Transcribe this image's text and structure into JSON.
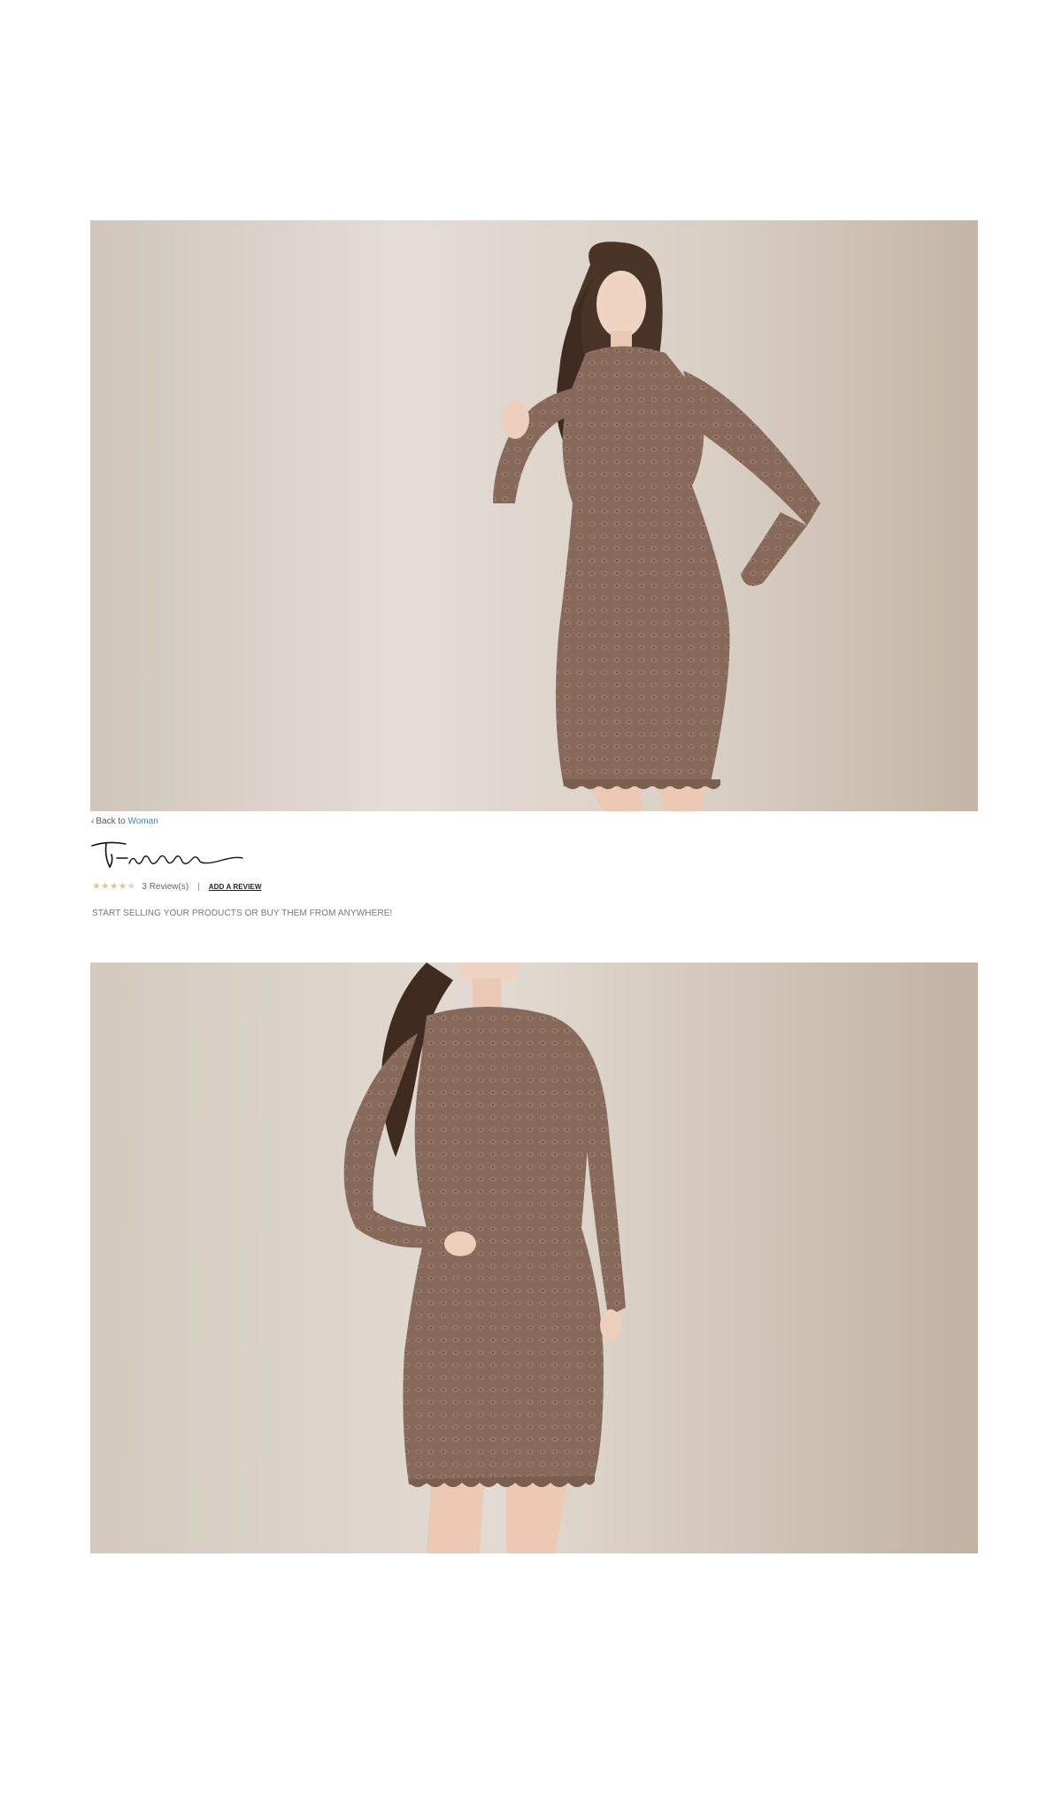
{
  "breadcrumb": {
    "prefix": "Back to",
    "category": "Woman"
  },
  "brand": {
    "logo_text": "T-nani"
  },
  "rating": {
    "stars": 4,
    "max_stars": 5,
    "review_count": "3 Review(s)",
    "separator": "|",
    "add_review_label": "ADD A REVIEW"
  },
  "tagline": "START SELLING YOUR PRODUCTS OR BUY THEM FROM ANYWHERE!",
  "colors": {
    "link": "#4a7fa8",
    "star_on": "#d9c79a",
    "star_off": "#d6d6d6",
    "dress": "#86695a",
    "wall": "#d6ccc2"
  },
  "icons": {
    "back": "chevron-left-icon",
    "star": "star-icon"
  }
}
